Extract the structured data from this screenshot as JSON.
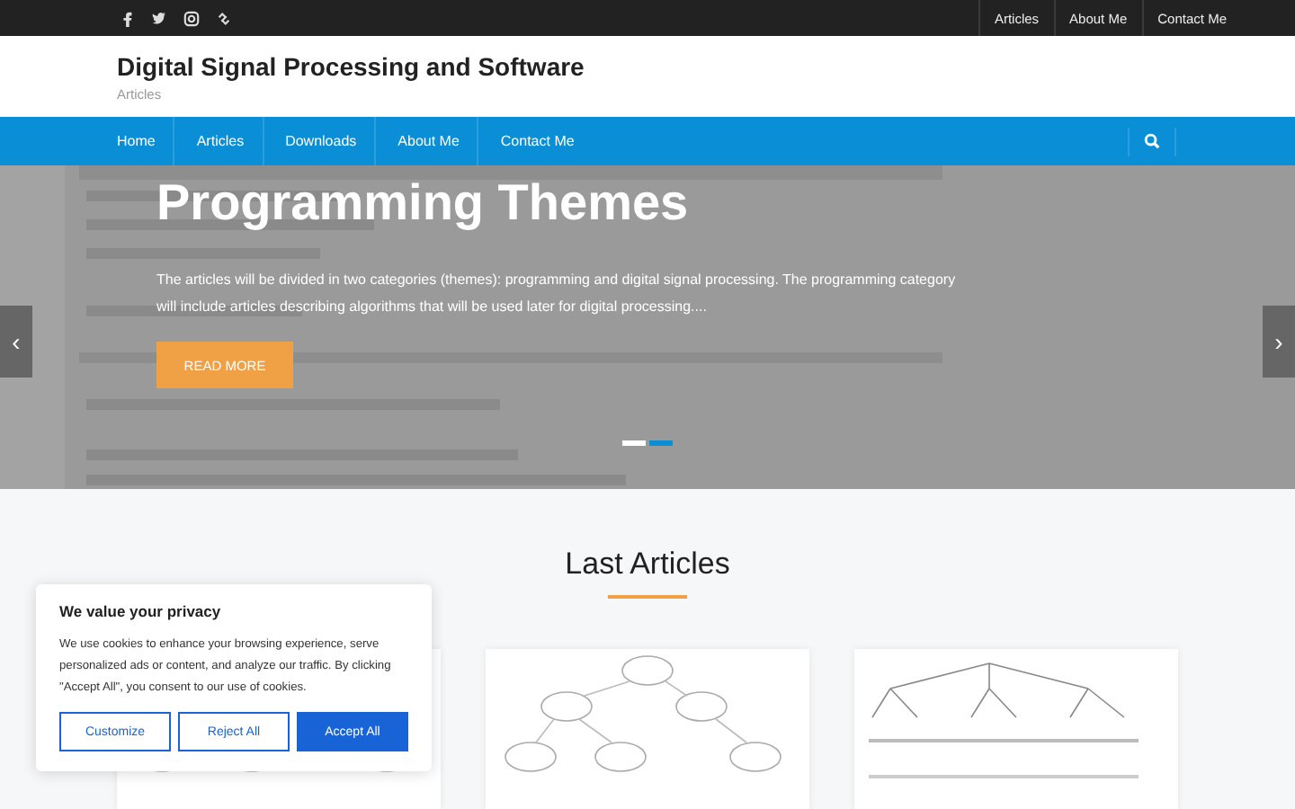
{
  "topbar": {
    "social": [
      {
        "kind": "facebook"
      },
      {
        "kind": "twitter"
      },
      {
        "kind": "instagram"
      },
      {
        "kind": "link"
      }
    ],
    "links": [
      "Articles",
      "About Me",
      "Contact Me"
    ]
  },
  "header": {
    "title": "Digital Signal Processing and Software",
    "tagline": "Articles"
  },
  "nav": {
    "items": [
      "Home",
      "Articles",
      "Downloads",
      "About Me",
      "Contact Me"
    ]
  },
  "hero": {
    "title": "Programming Themes",
    "text": "The articles will be divided in two categories (themes): programming and digital signal processing. The programming category will include articles describing algorithms that will be used later for digital processing....",
    "button": "READ MORE",
    "prev": "‹",
    "next": "›",
    "slides": [
      {
        "selected": false
      },
      {
        "selected": true
      }
    ]
  },
  "section": {
    "title": "Last Articles"
  },
  "cookie": {
    "title": "We value your privacy",
    "text": "We use cookies to enhance your browsing experience, serve personalized ads or content, and analyze our traffic. By clicking \"Accept All\", you consent to our use of cookies.",
    "buttons": [
      {
        "label": "Customize",
        "kind": "outline"
      },
      {
        "label": "Reject All",
        "kind": "outline"
      },
      {
        "label": "Accept All",
        "kind": "primary"
      }
    ]
  }
}
